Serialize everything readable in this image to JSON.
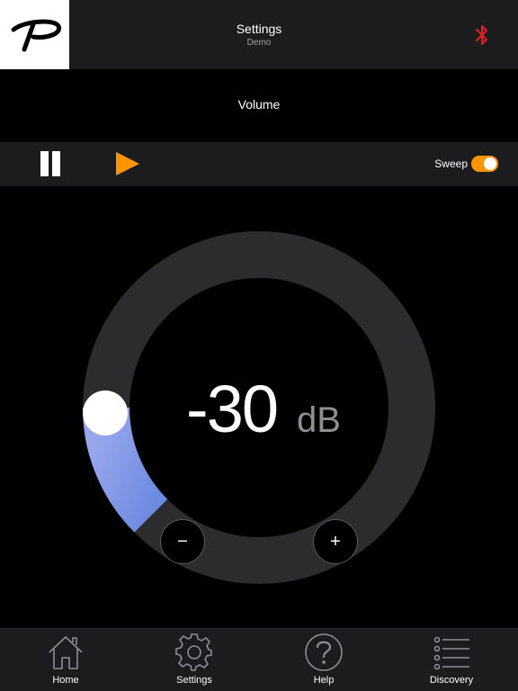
{
  "header": {
    "title": "Settings",
    "subtitle": "Demo",
    "logo_icon": "p-brand-logo",
    "bluetooth_icon": "bluetooth-icon",
    "bluetooth_color": "#e0201b"
  },
  "section": {
    "title": "Volume"
  },
  "transport": {
    "pause_icon": "pause-icon",
    "play_icon": "play-icon",
    "play_color": "#ff9500",
    "sweep_label": "Sweep",
    "sweep_enabled": true
  },
  "volume": {
    "value": "-30",
    "unit": "dB",
    "minus_label": "−",
    "plus_label": "+",
    "ring_color": "#2c2c2e",
    "level_gradient": [
      "#9aa7ee",
      "#6c8ae0"
    ]
  },
  "tabs": [
    {
      "label": "Home",
      "icon": "home-icon"
    },
    {
      "label": "Settings",
      "icon": "gear-icon"
    },
    {
      "label": "Help",
      "icon": "help-icon"
    },
    {
      "label": "Discovery",
      "icon": "list-icon"
    }
  ]
}
